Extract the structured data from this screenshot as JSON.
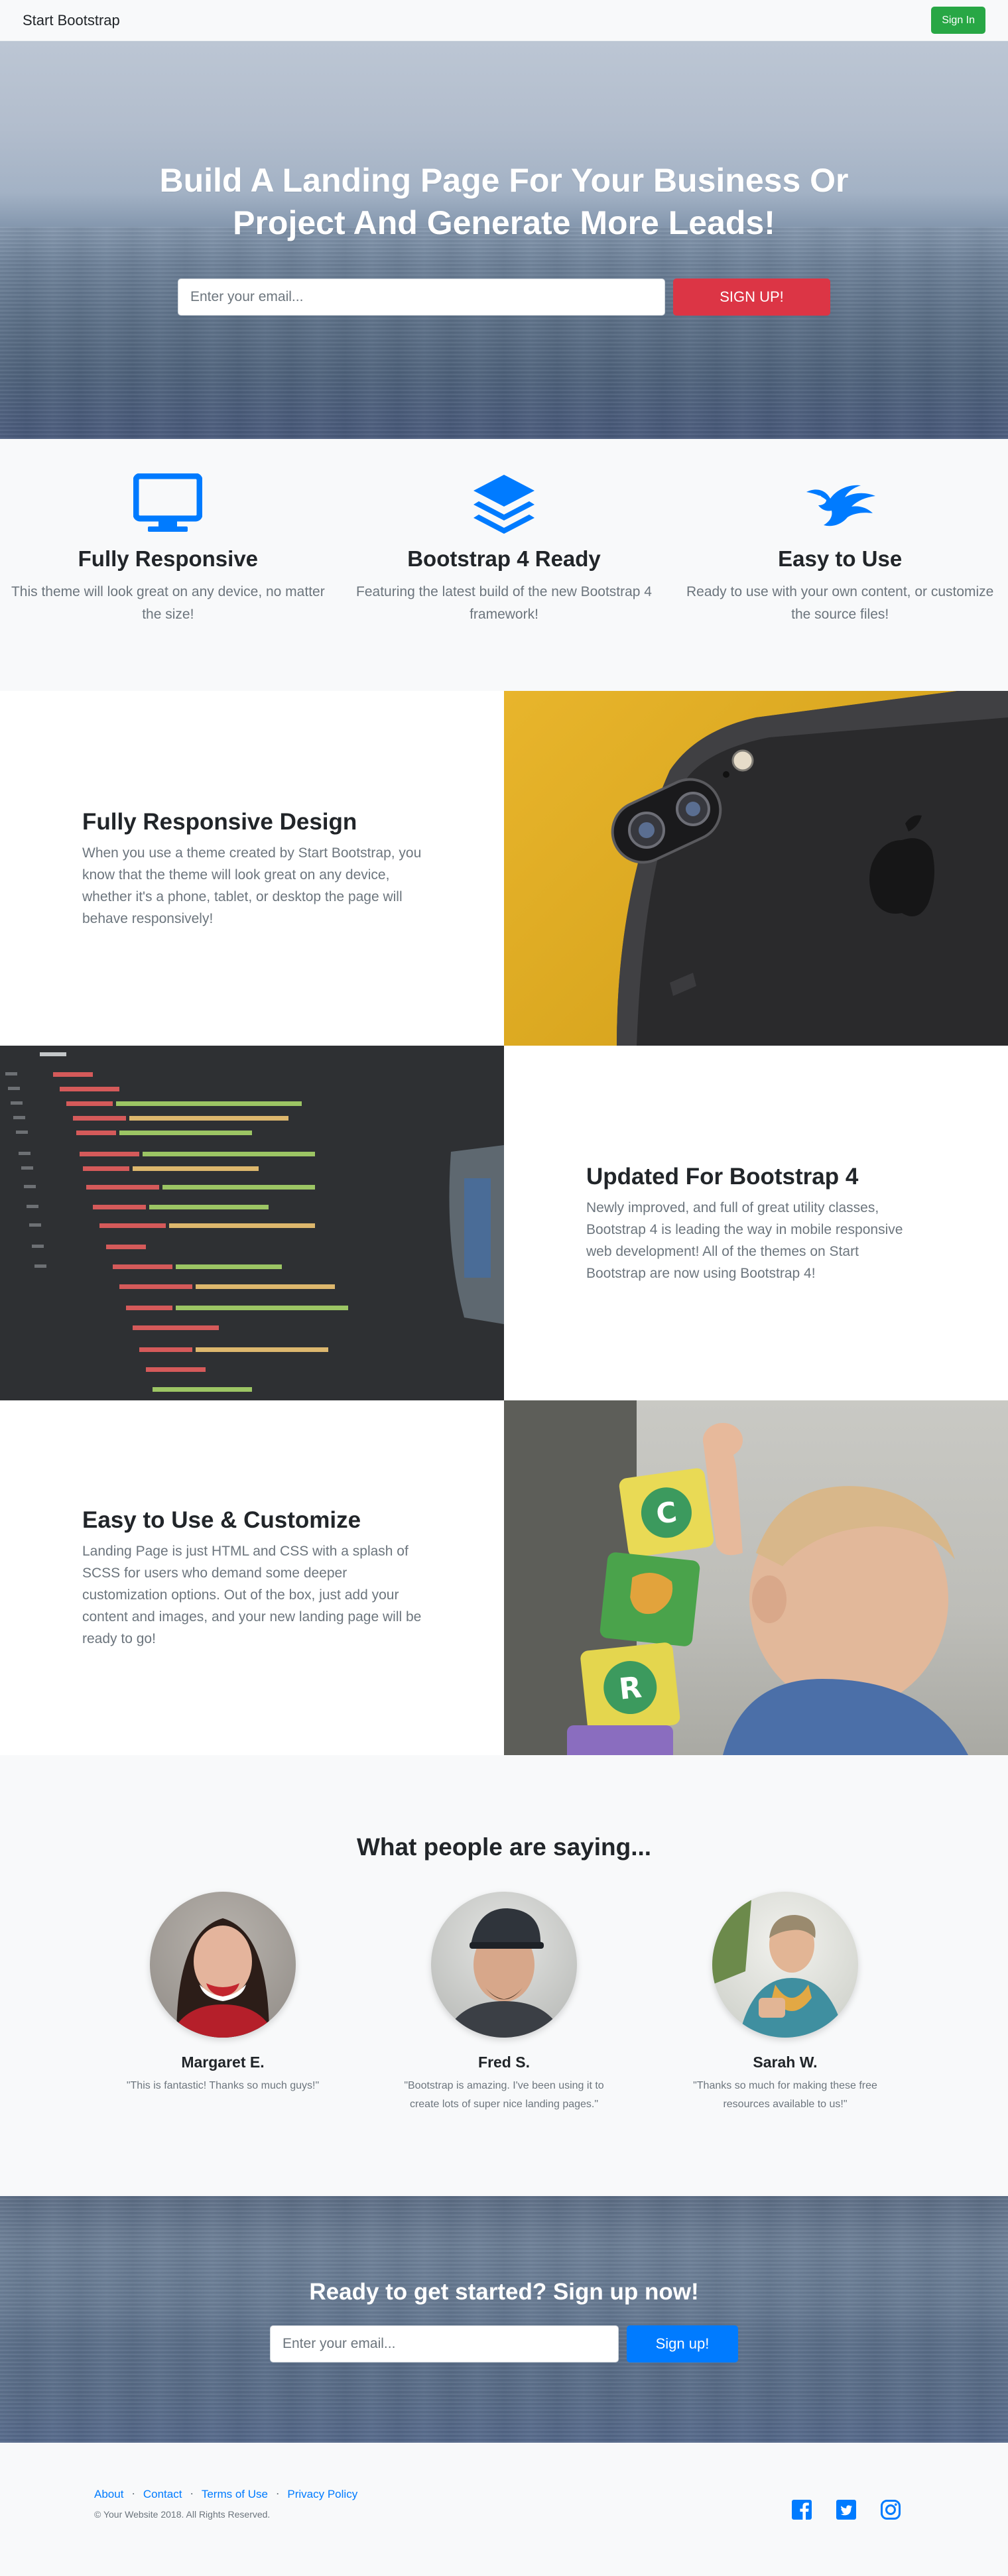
{
  "navbar": {
    "brand": "Start Bootstrap",
    "signin_label": "Sign In"
  },
  "hero": {
    "title": "Build A Landing Page For Your Business Or Project And Generate More Leads!",
    "email_placeholder": "Enter your email...",
    "signup_label": "SIGN UP!"
  },
  "features": [
    {
      "icon": "monitor-icon",
      "title": "Fully Responsive",
      "text": "This theme will look great on any device, no matter the size!"
    },
    {
      "icon": "layers-icon",
      "title": "Bootstrap 4 Ready",
      "text": "Featuring the latest build of the new Bootstrap 4 framework!"
    },
    {
      "icon": "bird-icon",
      "title": "Easy to Use",
      "text": "Ready to use with your own content, or customize the source files!"
    }
  ],
  "showcase": [
    {
      "title": "Fully Responsive Design",
      "text": "When you use a theme created by Start Bootstrap, you know that the theme will look great on any device, whether it's a phone, tablet, or desktop the page will behave responsively!"
    },
    {
      "title": "Updated For Bootstrap 4",
      "text": "Newly improved, and full of great utility classes, Bootstrap 4 is leading the way in mobile responsive web development! All of the themes on Start Bootstrap are now using Bootstrap 4!"
    },
    {
      "title": "Easy to Use & Customize",
      "text": "Landing Page is just HTML and CSS with a splash of SCSS for users who demand some deeper customization options. Out of the box, just add your content and images, and your new landing page will be ready to go!"
    }
  ],
  "testimonials": {
    "heading": "What people are saying...",
    "items": [
      {
        "name": "Margaret E.",
        "quote": "\"This is fantastic! Thanks so much guys!\""
      },
      {
        "name": "Fred S.",
        "quote": "\"Bootstrap is amazing. I've been using it to create lots of super nice landing pages.\""
      },
      {
        "name": "Sarah W.",
        "quote": "\"Thanks so much for making these free resources available to us!\""
      }
    ]
  },
  "cta": {
    "heading": "Ready to get started? Sign up now!",
    "email_placeholder": "Enter your email...",
    "signup_label": "Sign up!"
  },
  "footer": {
    "links": [
      "About",
      "Contact",
      "Terms of Use",
      "Privacy Policy"
    ],
    "copyright": "© Your Website 2018. All Rights Reserved.",
    "socials": [
      "facebook-icon",
      "twitter-icon",
      "instagram-icon"
    ]
  },
  "colors": {
    "primary": "#007bff",
    "success": "#28a745",
    "danger": "#dc3545",
    "muted": "#6c757d",
    "light": "#f8f9fa"
  }
}
